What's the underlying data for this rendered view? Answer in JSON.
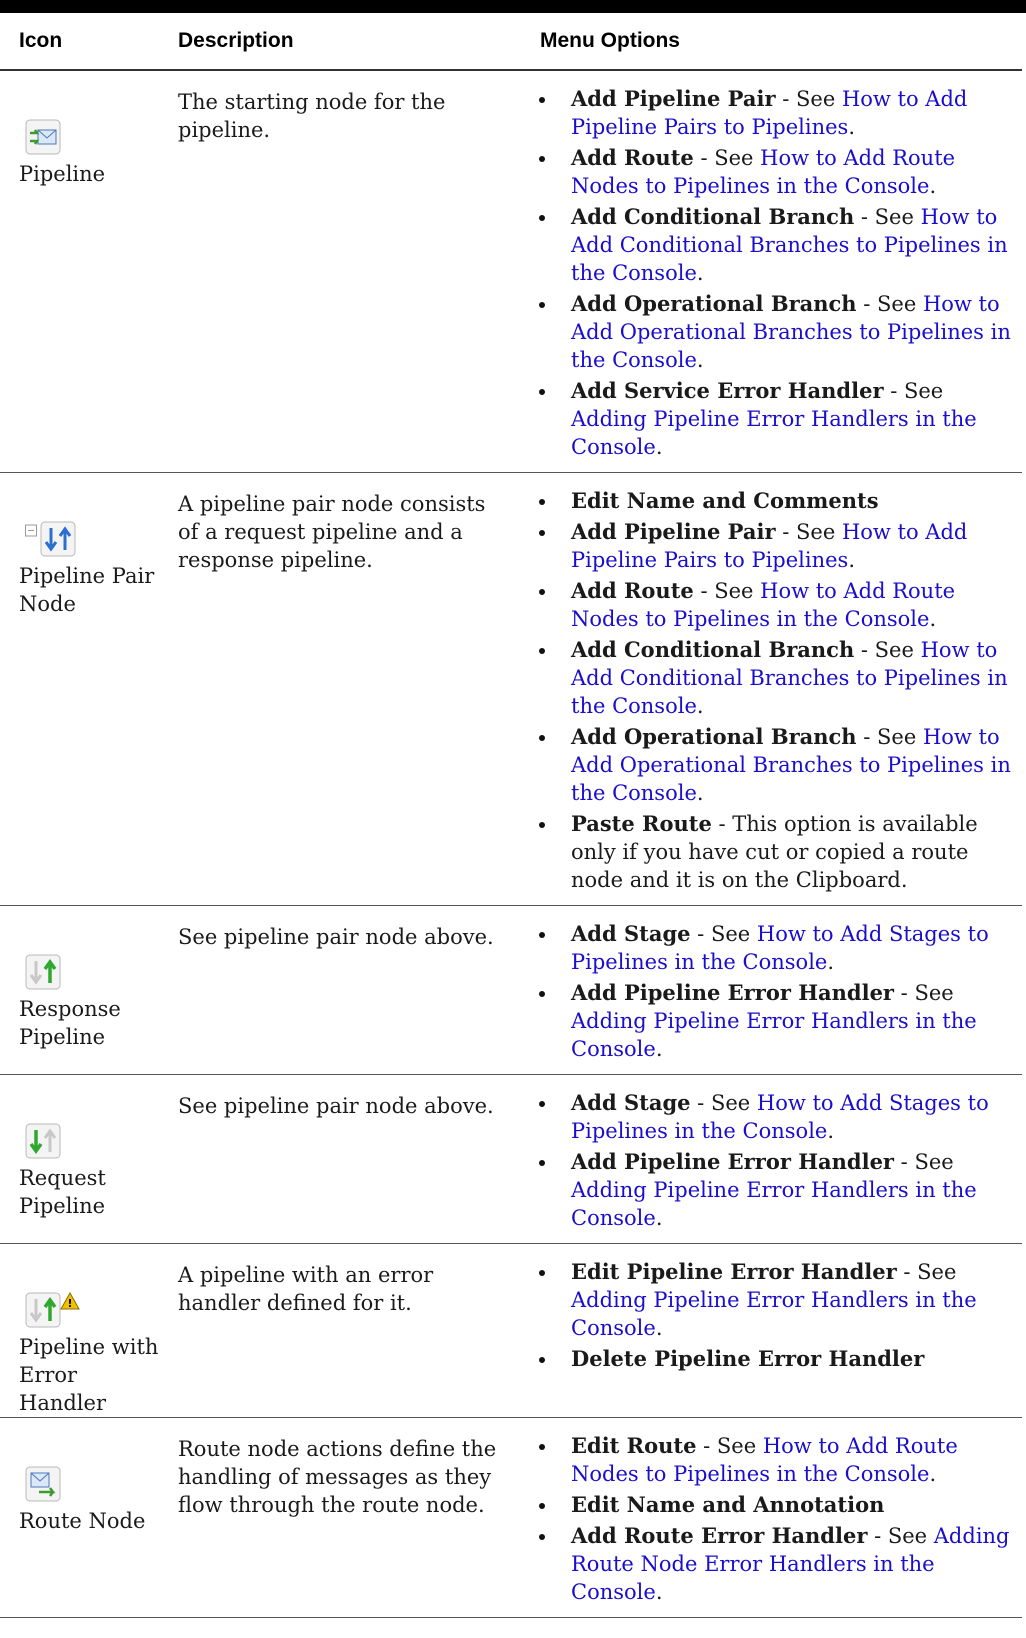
{
  "header": {
    "col_icon": "Icon",
    "col_desc": "Description",
    "col_menu": "Menu Options"
  },
  "colors": {
    "link": "#1a0dcc"
  },
  "rows": [
    {
      "icon": "pipeline-envelope-icon",
      "name": "Pipeline",
      "description": "The starting node for the pipeline.",
      "options": [
        {
          "label": "Add Pipeline Pair",
          "sep": " - See ",
          "link": "How to Add Pipeline Pairs to Pipelines",
          "end": "."
        },
        {
          "label": "Add Route",
          "sep": " - See ",
          "link": "How to Add Route Nodes to Pipelines in the Console",
          "end": "."
        },
        {
          "label": "Add Conditional Branch",
          "sep": " - See ",
          "link": "How to Add Conditional Branches to Pipelines in the Console",
          "end": "."
        },
        {
          "label": "Add Operational Branch",
          "sep": " - See ",
          "link": "How to Add Operational Branches to Pipelines in the Console",
          "end": "."
        },
        {
          "label": "Add Service Error Handler",
          "sep": " - See ",
          "link": "Adding Pipeline Error Handlers in the Console",
          "end": "."
        }
      ]
    },
    {
      "icon": "pipeline-pair-icon",
      "name": "Pipeline Pair Node",
      "description": "A pipeline pair node consists of a request pipeline and a response pipeline.",
      "options": [
        {
          "label": "Edit Name and Comments",
          "sep": "",
          "link": "",
          "end": ""
        },
        {
          "label": "Add Pipeline Pair",
          "sep": " - See ",
          "link": "How to Add Pipeline Pairs to Pipelines",
          "end": "."
        },
        {
          "label": "Add Route",
          "sep": " - See ",
          "link": "How to Add Route Nodes to Pipelines in the Console",
          "end": "."
        },
        {
          "label": "Add Conditional Branch",
          "sep": " - See ",
          "link": "How to Add Conditional Branches to Pipelines in the Console",
          "end": "."
        },
        {
          "label": "Add Operational Branch",
          "sep": " - See ",
          "link": "How to Add Operational Branches to Pipelines in the Console",
          "end": "."
        },
        {
          "label": "Paste Route",
          "sep": " - This option is available only if you have cut or copied a route node and it is on the Clipboard.",
          "link": "",
          "end": ""
        }
      ]
    },
    {
      "icon": "response-pipeline-icon",
      "name": "Response Pipeline",
      "description": "See pipeline pair node above.",
      "options": [
        {
          "label": "Add Stage",
          "sep": " - See ",
          "link": "How to Add Stages to Pipelines in the Console",
          "end": "."
        },
        {
          "label": "Add Pipeline Error Handler",
          "sep": " - See ",
          "link": "Adding Pipeline Error Handlers in the Console",
          "end": "."
        }
      ]
    },
    {
      "icon": "request-pipeline-icon",
      "name": "Request Pipeline",
      "description": "See pipeline pair node above.",
      "options": [
        {
          "label": "Add Stage",
          "sep": " - See ",
          "link": "How to Add Stages to Pipelines in the Console",
          "end": "."
        },
        {
          "label": "Add Pipeline Error Handler",
          "sep": " - See ",
          "link": "Adding Pipeline Error Handlers in the Console",
          "end": "."
        }
      ]
    },
    {
      "icon": "pipeline-error-handler-icon",
      "name": "Pipeline with Error Handler",
      "description": "A pipeline with an error handler defined for it.",
      "options": [
        {
          "label": "Edit Pipeline Error Handler",
          "sep": " - See ",
          "link": "Adding Pipeline Error Handlers in the Console",
          "end": "."
        },
        {
          "label": "Delete Pipeline Error Handler",
          "sep": "",
          "link": "",
          "end": ""
        }
      ]
    },
    {
      "icon": "route-node-icon",
      "name": "Route Node",
      "description": "Route node actions define the handling of messages as they flow through the route node.",
      "options": [
        {
          "label": "Edit Route",
          "sep": " - See ",
          "link": "How to Add Route Nodes to Pipelines in the Console",
          "end": "."
        },
        {
          "label": "Edit Name and Annotation",
          "sep": "",
          "link": "",
          "end": ""
        },
        {
          "label": "Add Route Error Handler",
          "sep": " - See ",
          "link": "Adding Route Node Error Handlers in the Console",
          "end": "."
        }
      ]
    }
  ]
}
